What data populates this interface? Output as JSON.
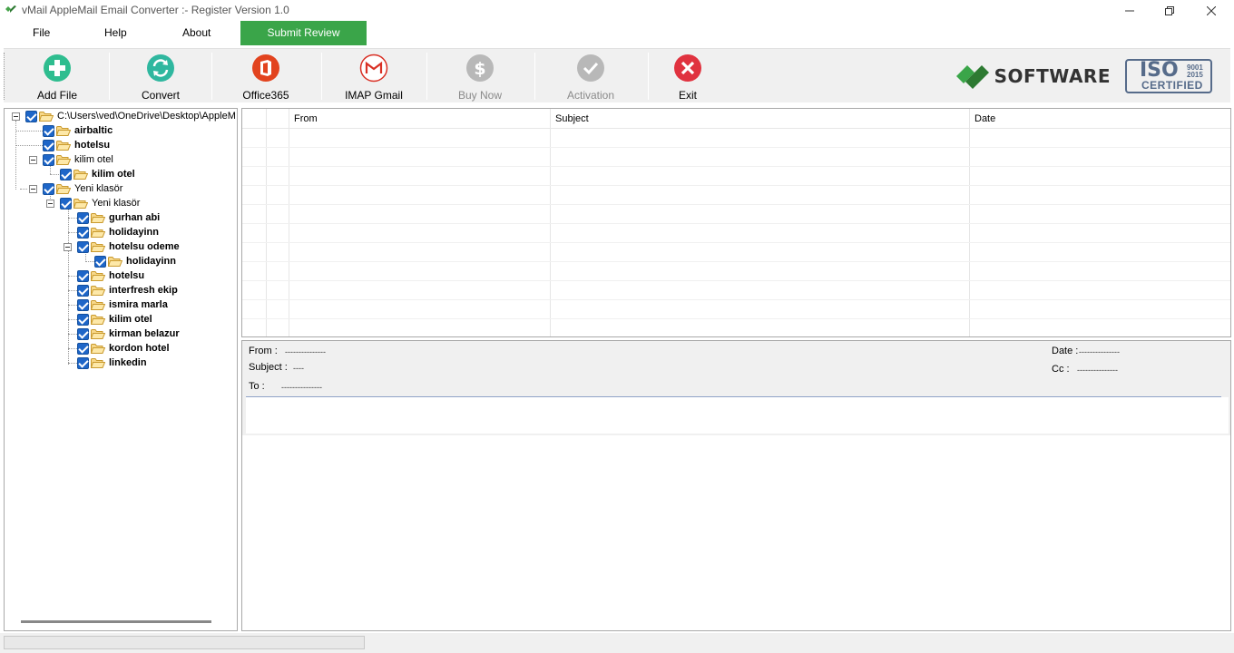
{
  "window": {
    "title": "vMail AppleMail Email Converter :- Register Version 1.0"
  },
  "menu": {
    "file": "File",
    "help": "Help",
    "about": "About",
    "submit_review": "Submit Review"
  },
  "toolbar": {
    "add_file": "Add File",
    "convert": "Convert",
    "office365": "Office365",
    "imap_gmail": "IMAP Gmail",
    "buy_now": "Buy Now",
    "activation": "Activation",
    "exit": "Exit"
  },
  "brand": {
    "name": "SOFTWARE",
    "iso_main": "ISO",
    "iso_year_1": "9001",
    "iso_year_2": "2015",
    "iso_certified": "CERTIFIED"
  },
  "tree": {
    "root": "C:\\Users\\ved\\OneDrive\\Desktop\\AppleM",
    "n1": "airbaltic",
    "n2": "hotelsu",
    "n3": "kilim otel",
    "n4": "kilim otel",
    "n5": "Yeni klasör",
    "n6": "Yeni klasör",
    "n7": "gurhan abi",
    "n8": "holidayinn",
    "n9": "hotelsu odeme",
    "n10": "holidayinn",
    "n11": "hotelsu",
    "n12": "interfresh ekip",
    "n13": "ismira marla",
    "n14": "kilim otel",
    "n15": "kirman belazur",
    "n16": "kordon hotel",
    "n17": "linkedin"
  },
  "grid": {
    "col_from": "From",
    "col_subject": "Subject",
    "col_date": "Date"
  },
  "preview": {
    "from_label": "From :",
    "from_value": "---------------",
    "subject_label": "Subject :",
    "subject_value": "----",
    "to_label": "To :",
    "to_value": "---------------",
    "date_label": "Date :",
    "date_value": "---------------",
    "cc_label": "Cc :",
    "cc_value": "---------------"
  },
  "colors": {
    "submit_green": "#3aa549",
    "add_green": "#2ebd8f",
    "convert_teal": "#2fb79f",
    "office_red": "#e2431e",
    "exit_red": "#e0323f",
    "disabled_gray": "#b8b8b8",
    "checkbox_blue": "#1e66c8"
  }
}
